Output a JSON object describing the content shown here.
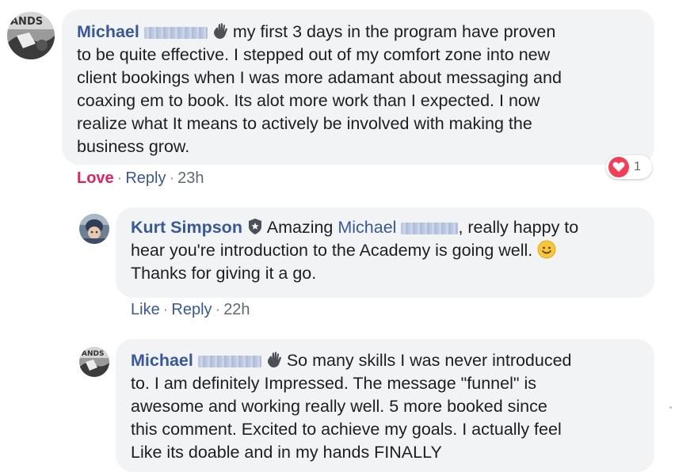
{
  "comments": [
    {
      "author": "Michael",
      "text": "my first 3 days in the program have proven to be quite effective. I stepped out of my comfort zone into new client bookings when I was more adamant about messaging and coaxing em to book. Its alot more work than I expected. I now realize what It means to actively be involved with making the business grow.",
      "lines": [
        "to be quite effective. I stepped out of my comfort zone into new",
        "client bookings when I was more adamant about messaging and",
        "coaxing em to book. Its alot more work than I expected. I now",
        "realize what It means to actively be involved with making the",
        "business grow."
      ],
      "first_line": "my first 3 days in the program have proven",
      "actions": {
        "reaction": "Love",
        "reply": "Reply",
        "time": "23h"
      },
      "reaction_count": "1",
      "reaction_icon": "heart-icon"
    },
    {
      "author": "Kurt Simpson",
      "first_line_a": "Amazing",
      "mention": "Michael",
      "first_line_b": ", really happy to",
      "lines": [
        "hear you're introduction to the Academy is going well.",
        "Thanks for giving it a go."
      ],
      "actions": {
        "reaction": "Like",
        "reply": "Reply",
        "time": "22h"
      },
      "badge_icon": "admin-shield-icon"
    },
    {
      "author": "Michael",
      "first_line": "So many skills I was never introduced",
      "lines": [
        "to. I am definitely Impressed. The message \"funnel\" is",
        "awesome and working really well. 5 more booked since",
        "this comment. Excited to achieve my goals. I actually feel",
        "Like its doable and in my hands FINALLY"
      ]
    }
  ],
  "separator": "·",
  "colors": {
    "link": "#385898",
    "love": "#e0245e",
    "bubble": "#f2f3f5",
    "heart": "#f33e58"
  }
}
